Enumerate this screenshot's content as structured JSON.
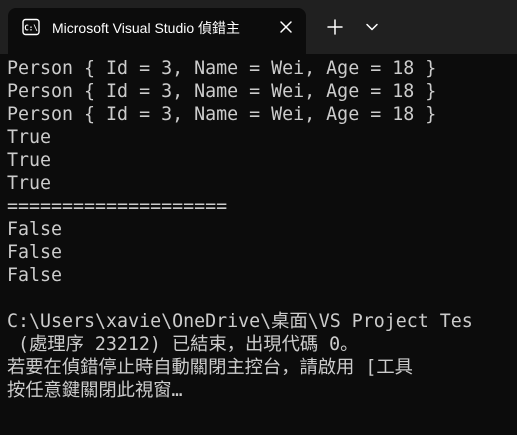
{
  "tab": {
    "title": "Microsoft Visual Studio 偵錯主",
    "icon": "console-icon"
  },
  "tabbar": {
    "new_tab_icon": "plus-icon",
    "dropdown_icon": "chevron-down-icon"
  },
  "console": {
    "lines": [
      "Person { Id = 3, Name = Wei, Age = 18 }",
      "Person { Id = 3, Name = Wei, Age = 18 }",
      "Person { Id = 3, Name = Wei, Age = 18 }",
      "True",
      "True",
      "True",
      "====================",
      "False",
      "False",
      "False",
      "",
      "C:\\Users\\xavie\\OneDrive\\桌面\\VS Project Tes",
      " (處理序 23212) 已結束，出現代碼 0。",
      "若要在偵錯停止時自動關閉主控台，請啟用 [工具",
      "按任意鍵關閉此視窗…"
    ]
  },
  "colors": {
    "background": "#0c0c0c",
    "tabbar": "#202020",
    "text": "#cccccc",
    "tab_title": "#ffffff"
  }
}
